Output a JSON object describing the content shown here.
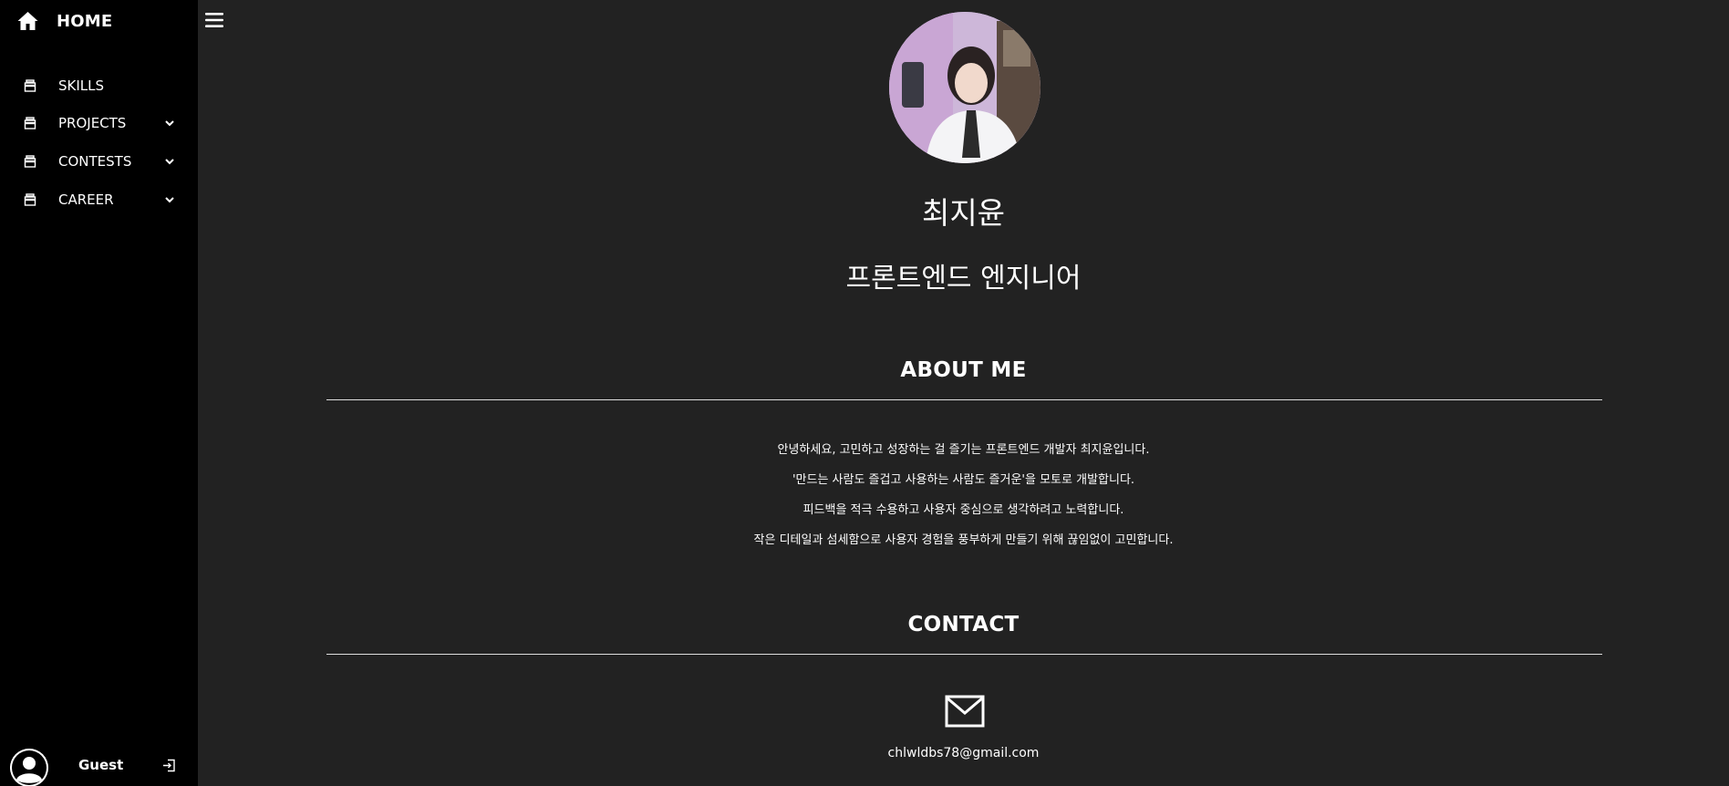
{
  "sidebar": {
    "home_label": "HOME",
    "items": [
      {
        "label": "SKILLS",
        "icon": "archive-icon",
        "has_submenu": false
      },
      {
        "label": "PROJECTS",
        "icon": "archive-icon",
        "has_submenu": true
      },
      {
        "label": "CONTESTS",
        "icon": "archive-icon",
        "has_submenu": true
      },
      {
        "label": "CAREER",
        "icon": "archive-icon",
        "has_submenu": true
      }
    ],
    "user": {
      "name": "Guest",
      "avatar_icon": "user-avatar-icon",
      "logout_icon": "login-icon"
    }
  },
  "header": {
    "menu_icon": "hamburger-menu-icon"
  },
  "profile": {
    "name": "최지윤",
    "role": "프론트엔드 엔지니어"
  },
  "about": {
    "title": "ABOUT ME",
    "lines": [
      "안녕하세요, 고민하고 성장하는 걸 즐기는 프론트엔드 개발자 최지윤입니다.",
      "'만드는 사람도 즐겁고 사용하는 사람도 즐거운'을 모토로 개발합니다.",
      "피드백을 적극 수용하고 사용자 중심으로 생각하려고 노력합니다.",
      "작은 디테일과 섬세함으로 사용자 경험을 풍부하게 만들기 위해 끊임없이 고민합니다."
    ]
  },
  "contact": {
    "title": "CONTACT",
    "mail_icon": "mail-icon",
    "email": "chlwldbs78@gmail.com"
  },
  "colors": {
    "sidebar_bg": "#000000",
    "main_bg": "#222222",
    "text": "#ffffff",
    "divider": "#dddddd"
  }
}
